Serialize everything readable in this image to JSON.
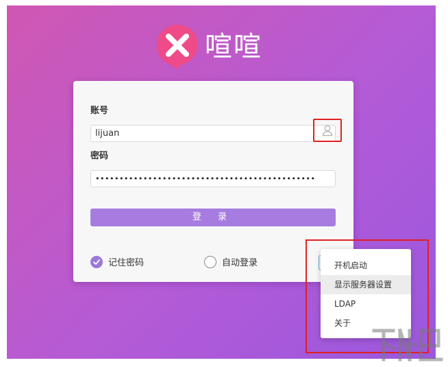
{
  "app": {
    "name": "喧喧"
  },
  "login_form": {
    "account_label": "账号",
    "account_value": "lijuan",
    "password_label": "密码",
    "password_value": "••••••••••••••••••••••••••••••••••••••••••••••",
    "login_button": "登 录",
    "remember_password": {
      "label": "记住密码",
      "checked": true
    },
    "auto_login": {
      "label": "自动登录",
      "checked": false
    }
  },
  "settings_menu": {
    "items": [
      {
        "label": "开机启动"
      },
      {
        "label": "显示服务器设置",
        "hovered": true
      },
      {
        "label": "LDAP"
      },
      {
        "label": "关于"
      }
    ]
  },
  "icons": {
    "logo": "x-chat-bubble-icon",
    "user_switch": "user-icon",
    "settings": "gear-icon",
    "checkbox_checked": "check-icon",
    "watermark": "xiazaiba-watermark"
  },
  "colors": {
    "background_start": "#d057b3",
    "background_end": "#9a57de",
    "logo_pink": "#ee4b88",
    "login_button": "#a77ce0",
    "highlight_red": "#e02020"
  }
}
